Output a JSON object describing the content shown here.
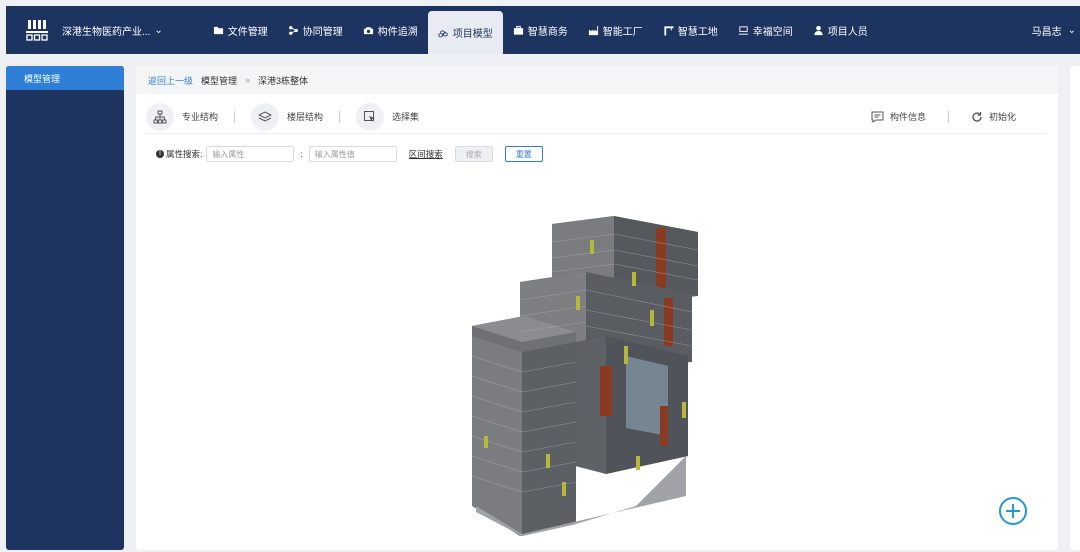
{
  "header": {
    "project_name": "深港生物医药产业...",
    "nav": [
      {
        "label": "文件管理",
        "icon": "folder-icon",
        "active": false
      },
      {
        "label": "协同管理",
        "icon": "share-icon",
        "active": false
      },
      {
        "label": "构件追溯",
        "icon": "camera-icon",
        "active": false
      },
      {
        "label": "项目模型",
        "icon": "cubes-icon",
        "active": true
      },
      {
        "label": "智慧商务",
        "icon": "briefcase-icon",
        "active": false
      },
      {
        "label": "智能工厂",
        "icon": "factory-icon",
        "active": false
      },
      {
        "label": "智慧工地",
        "icon": "crane-icon",
        "active": false
      },
      {
        "label": "幸福空间",
        "icon": "space-icon",
        "active": false
      },
      {
        "label": "项目人员",
        "icon": "person-icon",
        "active": false
      }
    ],
    "user_name": "马昌志"
  },
  "sidebar": {
    "items": [
      {
        "label": "模型管理"
      }
    ]
  },
  "breadcrumb": {
    "back": "返回上一级",
    "parent": "模型管理",
    "separator": "»",
    "current": "深港3栋整体"
  },
  "toolbar": {
    "specialty": "专业结构",
    "floor": "楼层结构",
    "selection": "选择集",
    "component_info": "构件信息",
    "reset_view": "初始化"
  },
  "search": {
    "label": "属性搜索:",
    "attr_placeholder": "输入属性",
    "colon": ":",
    "value_placeholder": "输入属性值",
    "range_link": "区间搜索",
    "search_btn": "搜索",
    "reset_btn": "重置"
  },
  "colors": {
    "nav_bg": "#1d3461",
    "accent": "#2f7fd6"
  }
}
